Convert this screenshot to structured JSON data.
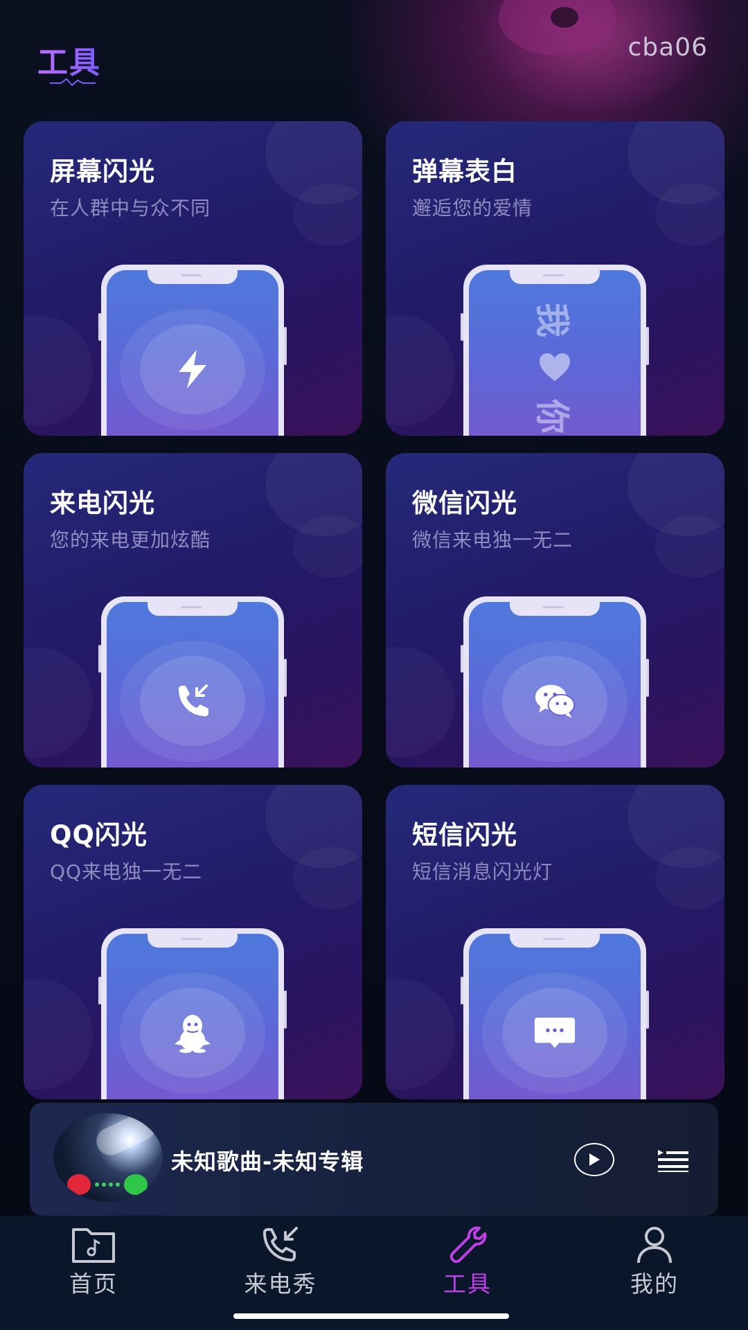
{
  "header": {
    "title": "工具",
    "username": "cba06"
  },
  "tools": [
    {
      "title": "屏幕闪光",
      "subtitle": "在人群中与众不同",
      "icon": "lightning-icon"
    },
    {
      "title": "弹幕表白",
      "subtitle": "邂逅您的爱情",
      "icon": "love-text",
      "love_text_top": "我",
      "love_text_bottom": "你"
    },
    {
      "title": "来电闪光",
      "subtitle": "您的来电更加炫酷",
      "icon": "incoming-call-icon"
    },
    {
      "title": "微信闪光",
      "subtitle": "微信来电独一无二",
      "icon": "wechat-icon"
    },
    {
      "title": "QQ闪光",
      "subtitle": "QQ来电独一无二",
      "icon": "qq-penguin-icon"
    },
    {
      "title": "短信闪光",
      "subtitle": "短信消息闪光灯",
      "icon": "sms-message-icon"
    }
  ],
  "player": {
    "song_title": "未知歌曲-未知专辑",
    "play_icon": "play-icon",
    "playlist_icon": "playlist-icon"
  },
  "tabbar": {
    "items": [
      {
        "label": "首页",
        "icon": "music-folder-icon",
        "active": false
      },
      {
        "label": "来电秀",
        "icon": "incoming-call-icon",
        "active": false
      },
      {
        "label": "工具",
        "icon": "wrench-icon",
        "active": true
      },
      {
        "label": "我的",
        "icon": "user-icon",
        "active": false
      }
    ]
  },
  "colors": {
    "accent": "#c040e8",
    "card_top": "#25297a",
    "card_bottom": "#3b125a",
    "phone_screen": "#4f79dc"
  }
}
